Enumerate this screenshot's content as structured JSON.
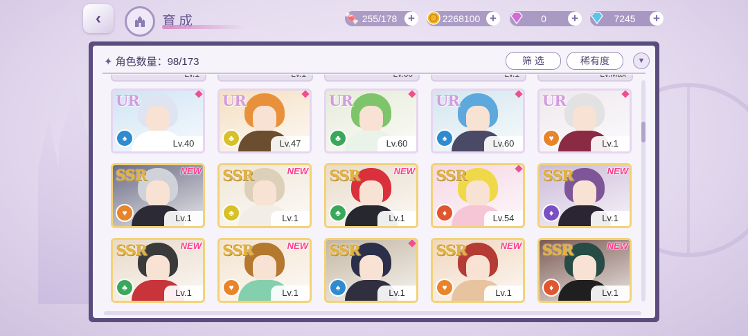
{
  "header": {
    "title": "育成",
    "resources": [
      {
        "icon": "candy-icon",
        "value": "255/178",
        "color": "#e96f91"
      },
      {
        "icon": "gold-coin-icon",
        "value": "2268100",
        "color": "#f2b42a"
      },
      {
        "icon": "pink-diamond-icon",
        "value": "0",
        "color": "#d46ad9"
      },
      {
        "icon": "blue-diamond-icon",
        "value": "7245",
        "color": "#5ac4ec"
      }
    ]
  },
  "panel": {
    "count_label": "角色数量：98/173",
    "filter_button": "筛 选",
    "rarity_button": "稀有度"
  },
  "peek_levels": [
    "Lv.1",
    "Lv.1",
    "Lv.60",
    "Lv.1",
    "Lv.Max"
  ],
  "cards": [
    {
      "rarity": "UR",
      "level": "Lv.40",
      "tag": "dot",
      "attr_color": "#2f8bd0",
      "attr_icon": "♠",
      "hair": "#dfe4f2",
      "body": "#ffffff",
      "bg": "#cfe4f4"
    },
    {
      "rarity": "UR",
      "level": "Lv.47",
      "tag": "dot",
      "attr_color": "#d8c126",
      "attr_icon": "♣",
      "hair": "#e8913a",
      "body": "#6b4d2f",
      "bg": "#f4dfc2"
    },
    {
      "rarity": "UR",
      "level": "Lv.60",
      "tag": "dot",
      "attr_color": "#3aa85b",
      "attr_icon": "♣",
      "hair": "#7ec46a",
      "body": "#e9f3ea",
      "bg": "#e6ebd8"
    },
    {
      "rarity": "UR",
      "level": "Lv.60",
      "tag": "dot",
      "attr_color": "#2f8bd0",
      "attr_icon": "♠",
      "hair": "#5da8dc",
      "body": "#4a4a66",
      "bg": "#d3e6ef"
    },
    {
      "rarity": "UR",
      "level": "Lv.1",
      "tag": "dot",
      "attr_color": "#e8842b",
      "attr_icon": "♥",
      "hair": "#e2e2e2",
      "body": "#8a2a43",
      "bg": "#eee8ee"
    },
    {
      "rarity": "SSR",
      "level": "Lv.1",
      "tag": "NEW",
      "attr_color": "#e8842b",
      "attr_icon": "♥",
      "hair": "#cfd2d8",
      "body": "#2c2a34",
      "bg": "#6c6c86"
    },
    {
      "rarity": "SSR",
      "level": "Lv.1",
      "tag": "NEW",
      "attr_color": "#d8c126",
      "attr_icon": "♣",
      "hair": "#dcd0b8",
      "body": "#f2ede6",
      "bg": "#efe6d6"
    },
    {
      "rarity": "SSR",
      "level": "Lv.1",
      "tag": "NEW",
      "attr_color": "#3aa85b",
      "attr_icon": "♣",
      "hair": "#d9303b",
      "body": "#27272f",
      "bg": "#e8dcca"
    },
    {
      "rarity": "SSR",
      "level": "Lv.54",
      "tag": "dot",
      "attr_color": "#e0562e",
      "attr_icon": "♦",
      "hair": "#f0d948",
      "body": "#f6c6d6",
      "bg": "#f5d7e5"
    },
    {
      "rarity": "SSR",
      "level": "Lv.1",
      "tag": "NEW",
      "attr_color": "#7b4fc4",
      "attr_icon": "♦",
      "hair": "#7e5596",
      "body": "#2b2533",
      "bg": "#cbbbd9"
    },
    {
      "rarity": "SSR",
      "level": "Lv.1",
      "tag": "NEW",
      "attr_color": "#3aa85b",
      "attr_icon": "♣",
      "hair": "#3a3a3a",
      "body": "#c73439",
      "bg": "#e8d9c8"
    },
    {
      "rarity": "SSR",
      "level": "Lv.1",
      "tag": "NEW",
      "attr_color": "#e8842b",
      "attr_icon": "♥",
      "hair": "#b4782f",
      "body": "#84cfae",
      "bg": "#f3e3cf"
    },
    {
      "rarity": "SSR",
      "level": "Lv.1",
      "tag": "dot",
      "attr_color": "#2f8bd0",
      "attr_icon": "♠",
      "hair": "#2c2f4a",
      "body": "#2f2f3f",
      "bg": "#c4b7a3"
    },
    {
      "rarity": "SSR",
      "level": "Lv.1",
      "tag": "NEW",
      "attr_color": "#e8842b",
      "attr_icon": "♥",
      "hair": "#b53c34",
      "body": "#e7c49f",
      "bg": "#f0d6bd"
    },
    {
      "rarity": "SSR",
      "level": "Lv.1",
      "tag": "NEW",
      "attr_color": "#e0562e",
      "attr_icon": "♦",
      "hair": "#274b45",
      "body": "#1f1f1f",
      "bg": "#7c5a52"
    }
  ]
}
